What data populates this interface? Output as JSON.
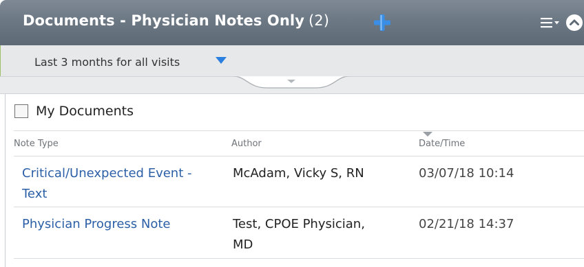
{
  "header": {
    "title": "Documents - Physician Notes Only",
    "count": "(2)",
    "add_icon": "plus-icon",
    "menu_icon": "menu-dropdown-icon",
    "collapse_icon": "collapse-up-icon",
    "bg_color": "#6c7884",
    "add_color": "#3a8ee6"
  },
  "filter": {
    "label": "Last 3 months for all visits",
    "caret_icon": "caret-down-icon",
    "caret_color": "#2a7fe0"
  },
  "drawer": {
    "icon": "drawer-toggle-icon"
  },
  "my_documents": {
    "label": "My Documents",
    "checked": false
  },
  "table": {
    "columns": [
      "Note Type",
      "Author",
      "Date/Time"
    ],
    "sort_icon": "sort-desc-icon",
    "rows": [
      {
        "note_type": [
          "Critical/Unexpected Event -",
          "Text"
        ],
        "author": [
          "McAdam, Vicky S, RN"
        ],
        "datetime": "03/07/18 10:14"
      },
      {
        "note_type": [
          "Physician Progress Note"
        ],
        "author": [
          "Test, CPOE Physician,",
          "MD"
        ],
        "datetime": "02/21/18 14:37"
      }
    ]
  }
}
